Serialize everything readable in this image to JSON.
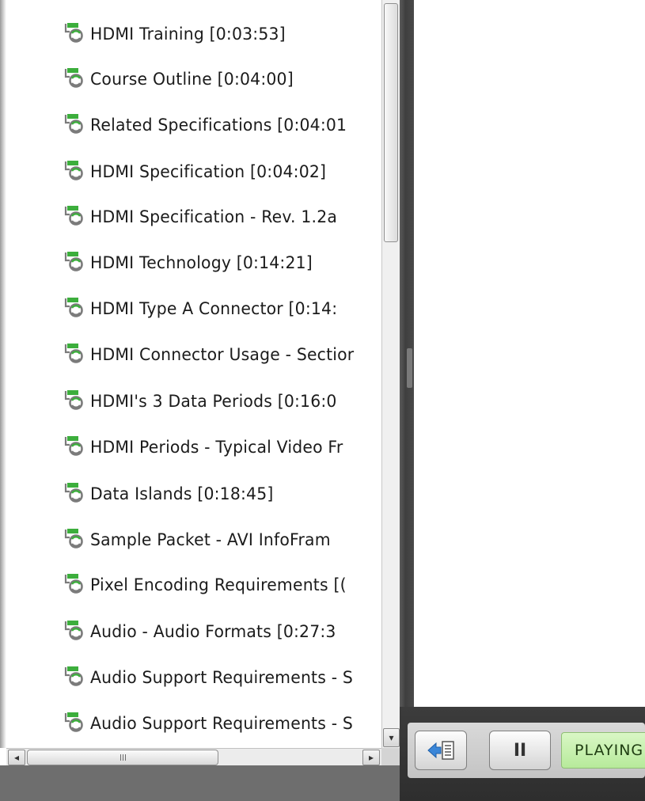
{
  "outline": {
    "items": [
      {
        "label": "HDMI Training  [0:03:53]"
      },
      {
        "label": "Course Outline  [0:04:00]"
      },
      {
        "label": "Related Specifications  [0:04:01"
      },
      {
        "label": "HDMI Specification  [0:04:02]"
      },
      {
        "label": "HDMI Specification - Rev. 1.2a"
      },
      {
        "label": "HDMI Technology  [0:14:21]"
      },
      {
        "label": "HDMI Type A Connector  [0:14:"
      },
      {
        "label": "HDMI Connector Usage - Sectior"
      },
      {
        "label": "HDMI's 3 Data Periods  [0:16:0"
      },
      {
        "label": "HDMI Periods - Typical Video Fr"
      },
      {
        "label": "Data Islands  [0:18:45]"
      },
      {
        "label": "Sample Packet  - AVI InfoFram"
      },
      {
        "label": "Pixel Encoding Requirements  [("
      },
      {
        "label": "Audio - Audio Formats  [0:27:3"
      },
      {
        "label": "Audio Support Requirements - S"
      },
      {
        "label": "Audio Support Requirements - S"
      }
    ],
    "item_icon": "slide-refresh-icon"
  },
  "scrollbars": {
    "horizontal_grip": "III",
    "left_arrow": "◂",
    "right_arrow": "▸",
    "down_arrow": "▾"
  },
  "player": {
    "toc_button_icon": "toc-toggle-icon",
    "pause_label": "II",
    "status": "PLAYING"
  },
  "colors": {
    "icon_green": "#3cae3c",
    "icon_gray": "#7b7b7b",
    "status_green": "#c6f0ad",
    "toc_arrow_blue": "#3a86d8"
  }
}
